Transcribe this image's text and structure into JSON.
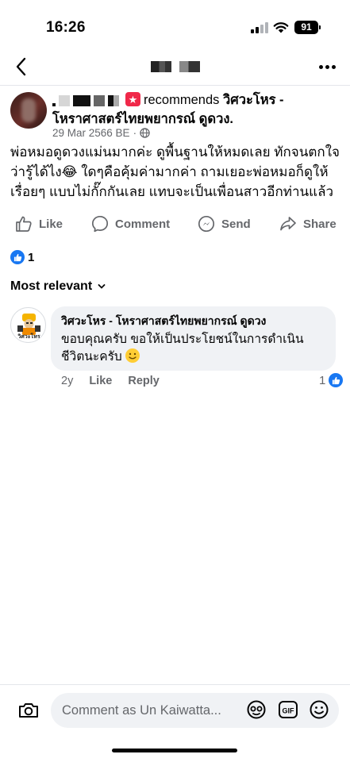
{
  "status_bar": {
    "time": "16:26",
    "battery": "91"
  },
  "nav": {
    "back_icon": "chevron-left-icon",
    "more_icon": "ellipsis-icon"
  },
  "post": {
    "recommends": "recommends",
    "page_name": "วิศวะโหร - โหราศาสตร์ไทยพยากรณ์ ดูดวง.",
    "date": "29 Mar 2566 BE",
    "privacy_icon": "globe-icon",
    "body_line1": "พ่อหมอดูดวงแม่นมากค่ะ ดูพื้นฐานให้หมดเลย ทักจนตกใจว่ารู้ได้ไง😂 ใดๆคือคุ้มค่ามากค่า ถามเยอะพ่อหมอก็ดูให้เรื่อยๆ แบบไม่กั๊กกันเลย แทบจะเป็นเพื่อนสาวอีกท่านแล้ว"
  },
  "actions": {
    "like": "Like",
    "comment": "Comment",
    "send": "Send",
    "share": "Share"
  },
  "reactions": {
    "count": "1"
  },
  "comments_section": {
    "sort_label": "Most relevant"
  },
  "comment": {
    "author": "วิศวะโหร - โหราศาสตร์ไทยพยากรณ์ ดูดวง",
    "text": "ขอบคุณครับ ขอให้เป็นประโยชน์ในการดำเนินชีวิตนะครับ",
    "age": "2y",
    "like": "Like",
    "reply": "Reply",
    "reaction_count": "1",
    "avatar_label": "วิศวะโหร"
  },
  "composer": {
    "placeholder": "Comment as Un Kaiwatta..."
  },
  "colors": {
    "accent": "#1877f2",
    "recommend_red": "#f02849",
    "secondary_text": "#65676b",
    "bubble_bg": "#f0f2f5"
  }
}
